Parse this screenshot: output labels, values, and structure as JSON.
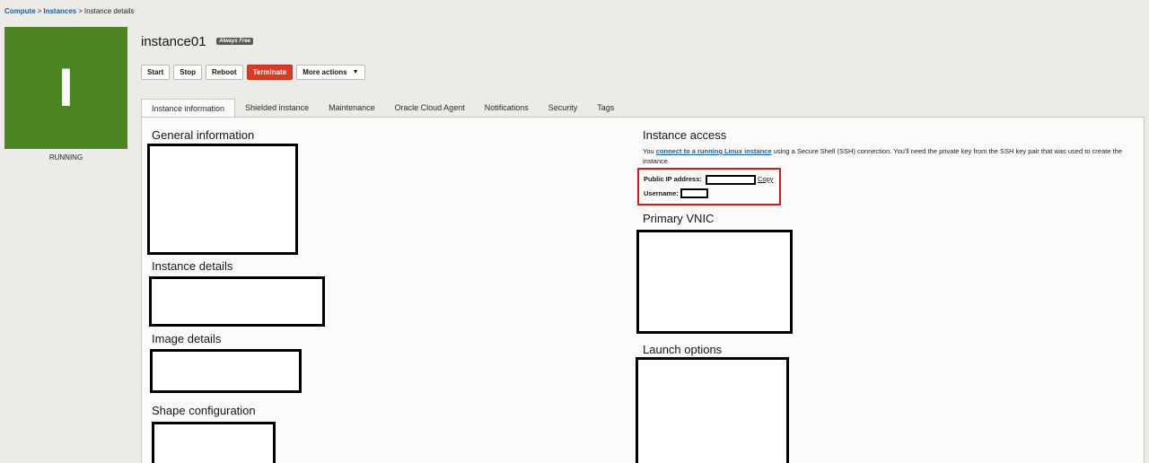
{
  "breadcrumb": {
    "compute": "Compute",
    "instances": "Instances",
    "current": "Instance details",
    "separator": ">"
  },
  "status_tile": {
    "letter": "I",
    "status": "RUNNING",
    "color": "#4c8624"
  },
  "header": {
    "title": "instance01",
    "badge": "Always Free"
  },
  "actions": {
    "start": "Start",
    "stop": "Stop",
    "reboot": "Reboot",
    "terminate": "Terminate",
    "more": "More actions"
  },
  "tabs": [
    {
      "label": "Instance information",
      "active": true
    },
    {
      "label": "Shielded instance"
    },
    {
      "label": "Maintenance"
    },
    {
      "label": "Oracle Cloud Agent"
    },
    {
      "label": "Notifications"
    },
    {
      "label": "Security"
    },
    {
      "label": "Tags"
    }
  ],
  "left_sections": {
    "general": "General information",
    "instance_details": "Instance details",
    "image_details": "Image details",
    "shape": "Shape configuration"
  },
  "access": {
    "heading": "Instance access",
    "text_before": "You ",
    "link": "connect to a running Linux instance",
    "text_after": " using a Secure Shell (SSH) connection. You'll need the private key from the SSH key pair that was used to create the instance.",
    "public_ip_label": "Public IP address:",
    "copy": "Copy",
    "username_label": "Username:"
  },
  "right_sections": {
    "vnic": "Primary VNIC",
    "launch": "Launch options"
  },
  "colors": {
    "danger": "#d63b25",
    "link": "#1a5e96",
    "highlight": "#d01a1a"
  }
}
